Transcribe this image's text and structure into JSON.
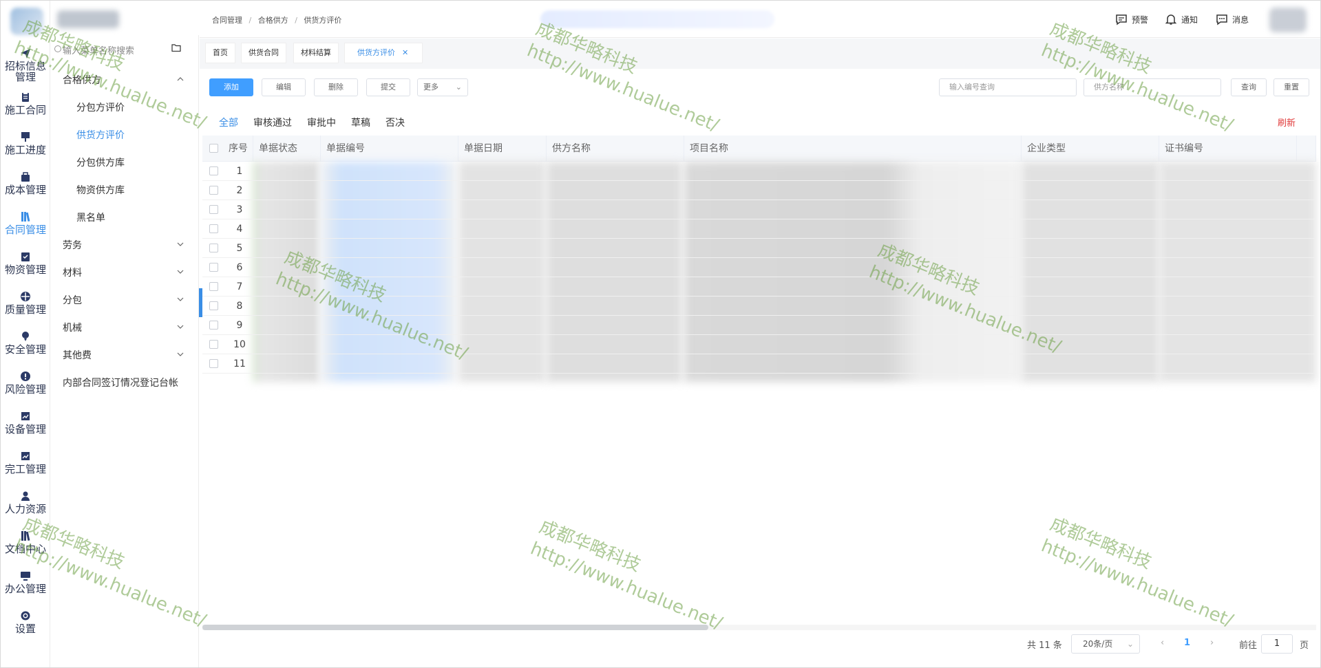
{
  "rail": [
    {
      "label": "招标信息管理",
      "icon": "send-icon"
    },
    {
      "label": "施工合同",
      "icon": "clipboard-icon"
    },
    {
      "label": "施工进度",
      "icon": "flag-icon"
    },
    {
      "label": "成本管理",
      "icon": "briefcase-icon"
    },
    {
      "label": "合同管理",
      "icon": "book-icon"
    },
    {
      "label": "物资管理",
      "icon": "checklist-icon"
    },
    {
      "label": "质量管理",
      "icon": "target-icon"
    },
    {
      "label": "安全管理",
      "icon": "pin-icon"
    },
    {
      "label": "风险管理",
      "icon": "alert-icon"
    },
    {
      "label": "设备管理",
      "icon": "chart-icon"
    },
    {
      "label": "完工管理",
      "icon": "chart-icon"
    },
    {
      "label": "人力资源",
      "icon": "user-icon"
    },
    {
      "label": "文档中心",
      "icon": "book-icon"
    },
    {
      "label": "办公管理",
      "icon": "monitor-icon"
    },
    {
      "label": "设置",
      "icon": "gear-icon"
    }
  ],
  "menu": {
    "search_placeholder": "输入菜单名称搜索",
    "groups": [
      {
        "label": "合格供方",
        "open": true,
        "items": [
          "分包方评价",
          "供货方评价",
          "分包供方库",
          "物资供方库",
          "黑名单"
        ]
      },
      {
        "label": "劳务"
      },
      {
        "label": "材料"
      },
      {
        "label": "分包"
      },
      {
        "label": "机械"
      },
      {
        "label": "其他费"
      }
    ],
    "extra": "内部合同签订情况登记台帐",
    "active_item": "供货方评价"
  },
  "header": {
    "breadcrumb": [
      "合同管理",
      "合格供方",
      "供货方评价"
    ],
    "warn": "预警",
    "notify": "通知",
    "message": "消息"
  },
  "tabs": [
    "首页",
    "供货合同",
    "材料结算",
    "供货方评价"
  ],
  "toolbar": {
    "add": "添加",
    "edit": "编辑",
    "delete": "删除",
    "submit": "提交",
    "more": "更多",
    "code_placeholder": "输入编号查询",
    "supplier_placeholder": "供方名称",
    "query": "查询",
    "reset": "重置"
  },
  "filter_tabs": [
    "全部",
    "审核通过",
    "审批中",
    "草稿",
    "否决"
  ],
  "refresh": "刷新",
  "table": {
    "columns": [
      "序号",
      "单据状态",
      "单据编号",
      "单据日期",
      "供方名称",
      "项目名称",
      "企业类型",
      "证书编号"
    ],
    "rows": [
      "1",
      "2",
      "3",
      "4",
      "5",
      "6",
      "7",
      "8",
      "9",
      "10",
      "11"
    ]
  },
  "pagination": {
    "total": "共 11 条",
    "page_size": "20条/页",
    "current": "1",
    "goto_label": "前往",
    "goto_value": "1",
    "page_unit": "页"
  },
  "watermark": {
    "line1": "成都华略科技",
    "line2": "http://www.hualue.net/"
  },
  "colors": {
    "accent": "#409eff",
    "refresh": "#e03a3a",
    "watermark": "#6ea046"
  }
}
